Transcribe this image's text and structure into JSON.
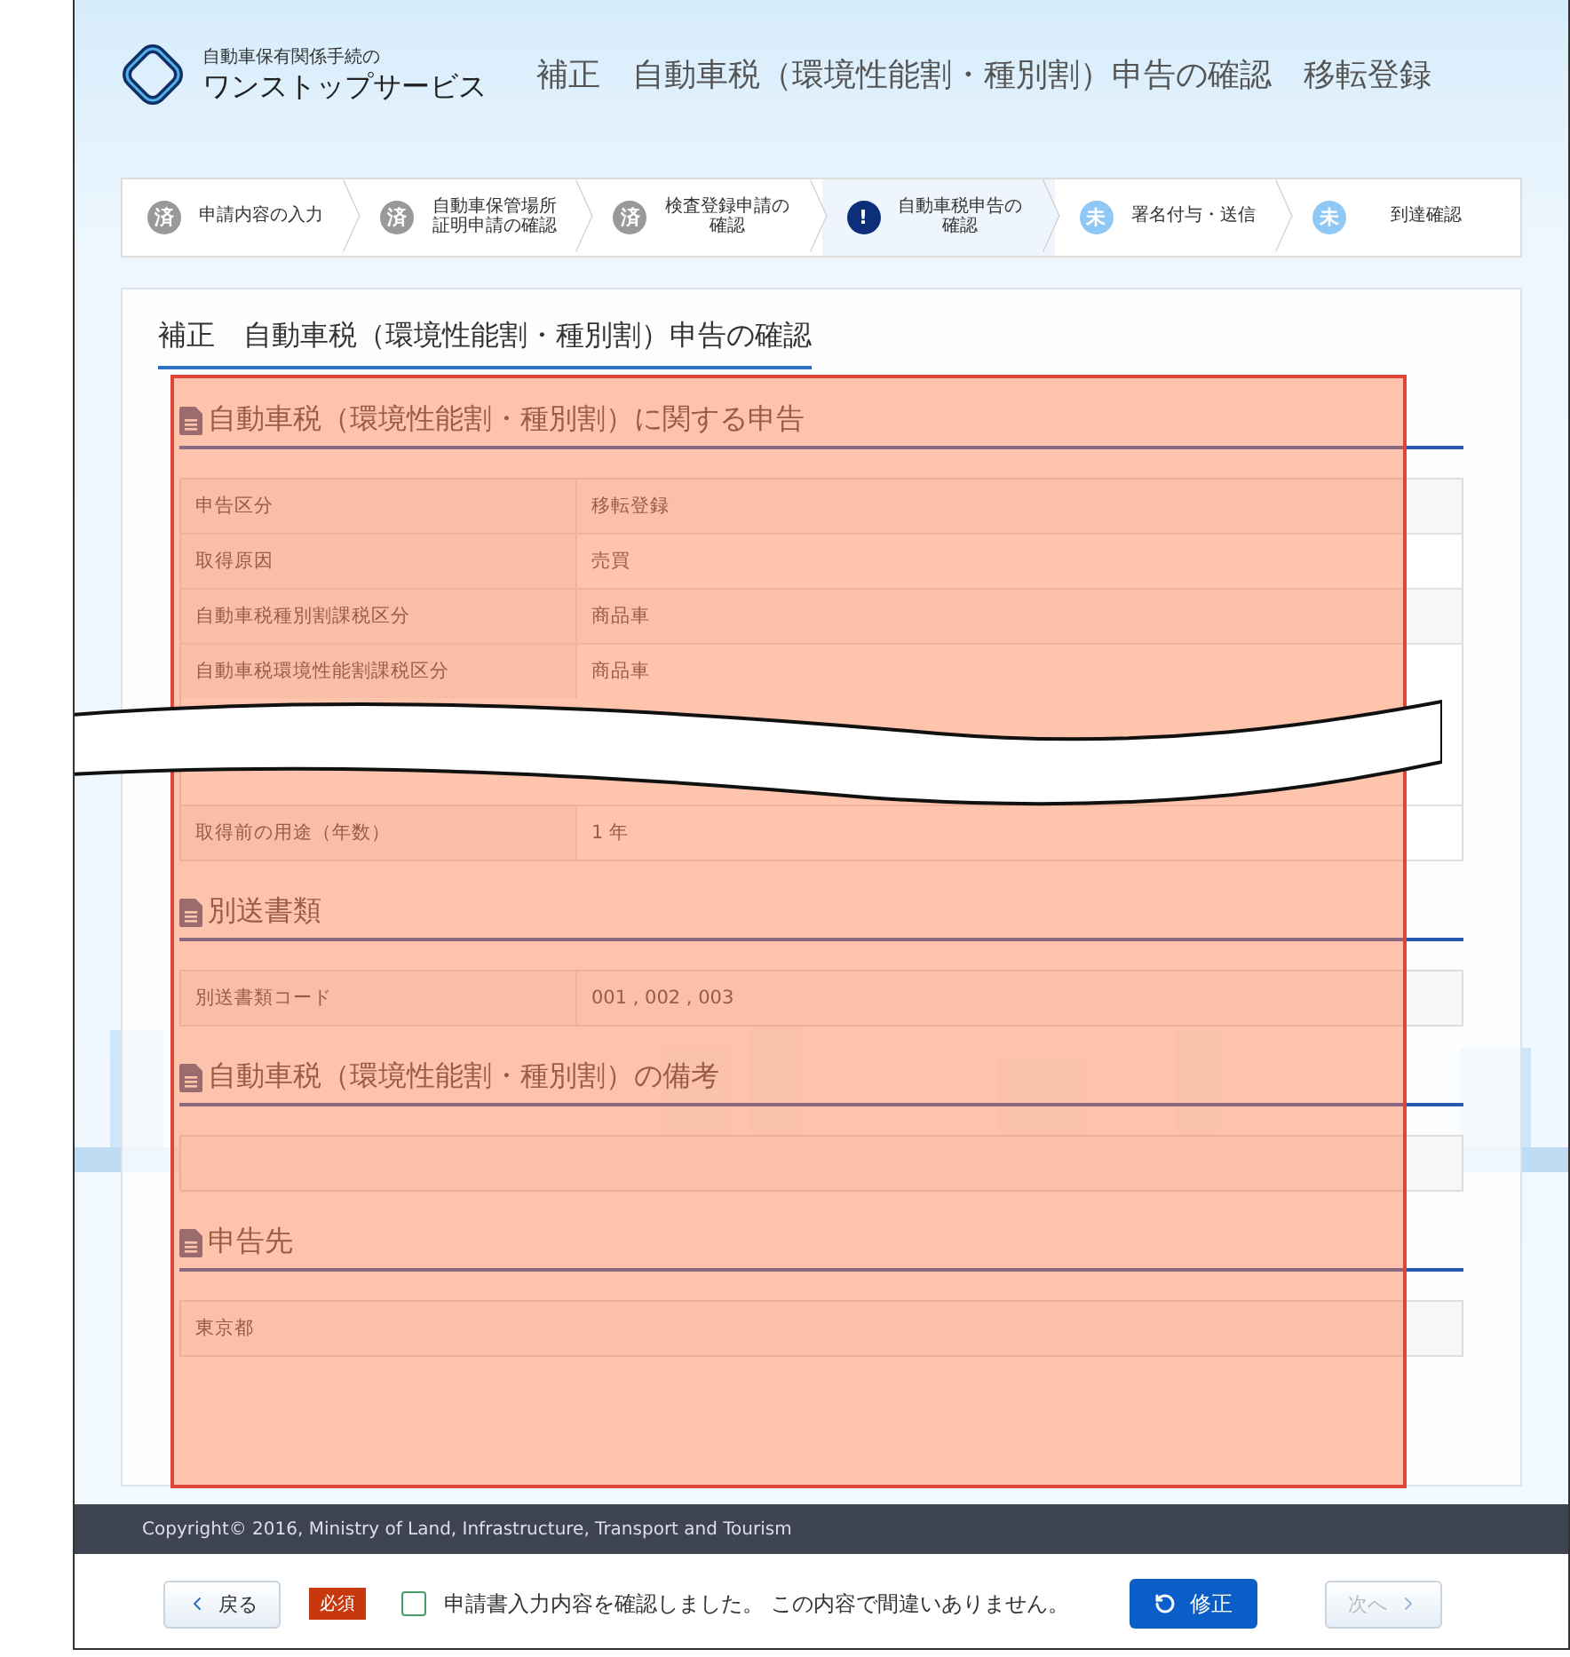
{
  "header": {
    "logo_caption": "自動車保有関係手続の",
    "logo_name": "ワンストップサービス",
    "title": "補正　自動車税（環境性能割・種別割）申告の確認　移転登録"
  },
  "steps": [
    {
      "badge": "済",
      "label": "申請内容の入力",
      "kind": "done",
      "selected": false
    },
    {
      "badge": "済",
      "label": "自動車保管場所証明申請の確認",
      "kind": "done",
      "selected": false
    },
    {
      "badge": "済",
      "label": "検査登録申請の確認",
      "kind": "done",
      "selected": false
    },
    {
      "badge": "!",
      "label": "自動車税申告の確認",
      "kind": "current",
      "selected": true
    },
    {
      "badge": "未",
      "label": "署名付与・送信",
      "kind": "todo",
      "selected": false
    },
    {
      "badge": "未",
      "label": "到達確認",
      "kind": "todo",
      "selected": false
    }
  ],
  "panel": {
    "title": "補正　自動車税（環境性能割・種別割）申告の確認"
  },
  "sections": [
    {
      "heading": "自動車税（環境性能割・種別割）に関する申告",
      "rows": [
        {
          "kind": "pair",
          "label": "申告区分",
          "value": "移転登録"
        },
        {
          "kind": "pair",
          "label": "取得原因",
          "value": "売買"
        },
        {
          "kind": "pair",
          "label": "自動車税種別割課税区分",
          "value": "商品車"
        },
        {
          "kind": "pair",
          "label": "自動車税環境性能割課税区分",
          "value": "商品車"
        },
        {
          "kind": "break"
        },
        {
          "kind": "pair",
          "label": "取得前の用途（年数）",
          "value": "1 年"
        }
      ]
    },
    {
      "heading": "別送書類",
      "rows": [
        {
          "kind": "pair",
          "label": "別送書類コード",
          "value": "001 , 002 , 003"
        }
      ]
    },
    {
      "heading": "自動車税（環境性能割・種別割）の備考",
      "rows": [
        {
          "kind": "empty"
        }
      ]
    },
    {
      "heading": "申告先",
      "rows": [
        {
          "kind": "single",
          "value": "東京都"
        }
      ]
    }
  ],
  "footer": {
    "copyright": "Copyright© 2016, Ministry of Land, Infrastructure, Transport and Tourism"
  },
  "actions": {
    "back": "戻る",
    "required": "必須",
    "confirm": {
      "label": "申請書入力内容を確認しました。 この内容で間違いありません。",
      "checked": false
    },
    "fix": "修正",
    "next": {
      "label": "次へ",
      "disabled": true
    }
  }
}
